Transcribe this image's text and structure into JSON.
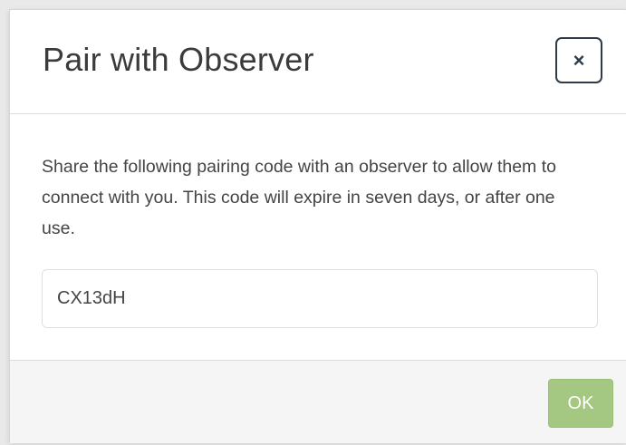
{
  "dialog": {
    "title": "Pair with Observer",
    "close_symbol": "×",
    "description": "Share the following pairing code with an observer to allow them to connect with you. This code will expire in seven days, or after one use.",
    "pairing_code": "CX13dH",
    "ok_label": "OK"
  },
  "colors": {
    "ok_button": "#a4c882",
    "close_border": "#2f3b48",
    "footer_bg": "#f5f5f5"
  },
  "icons": {
    "close": "close-icon"
  }
}
